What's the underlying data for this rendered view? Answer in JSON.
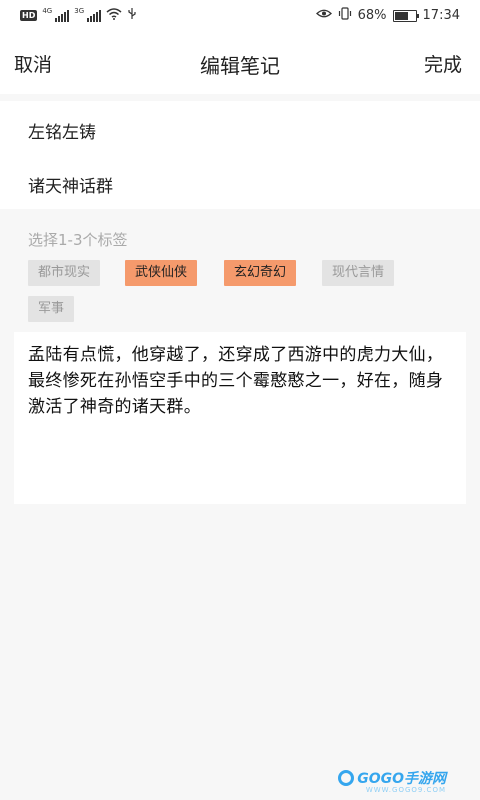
{
  "status_bar": {
    "network_badge": "HD",
    "network_gen_1": "4G",
    "network_gen_2": "3G",
    "battery_percent": "68%",
    "battery_level": 0.68,
    "time": "17:34",
    "icons": [
      "eye-icon",
      "vibrate-icon",
      "battery-icon",
      "wifi-icon",
      "usb-icon"
    ]
  },
  "header": {
    "cancel_label": "取消",
    "title": "编辑笔记",
    "done_label": "完成"
  },
  "form": {
    "field1_value": "左铭左铸",
    "field2_value": "诸天神话群"
  },
  "tags": {
    "hint": "选择1-3个标签",
    "items": [
      {
        "label": "都市现实",
        "selected": false
      },
      {
        "label": "武侠仙侠",
        "selected": true
      },
      {
        "label": "玄幻奇幻",
        "selected": true
      },
      {
        "label": "现代言情",
        "selected": false
      },
      {
        "label": "军事",
        "selected": false
      }
    ]
  },
  "content": {
    "text": "孟陆有点慌，他穿越了，还穿成了西游中的虎力大仙，最终惨死在孙悟空手中的三个霉憨憨之一，好在，随身激活了神奇的诸天群。"
  },
  "watermark": {
    "brand": "GOGO手游网",
    "url": "WWW.GOGO9.COM"
  },
  "colors": {
    "selected_tag": "#f59a6c",
    "unselected_tag": "#e3e3e3",
    "background": "#f7f7f7"
  }
}
